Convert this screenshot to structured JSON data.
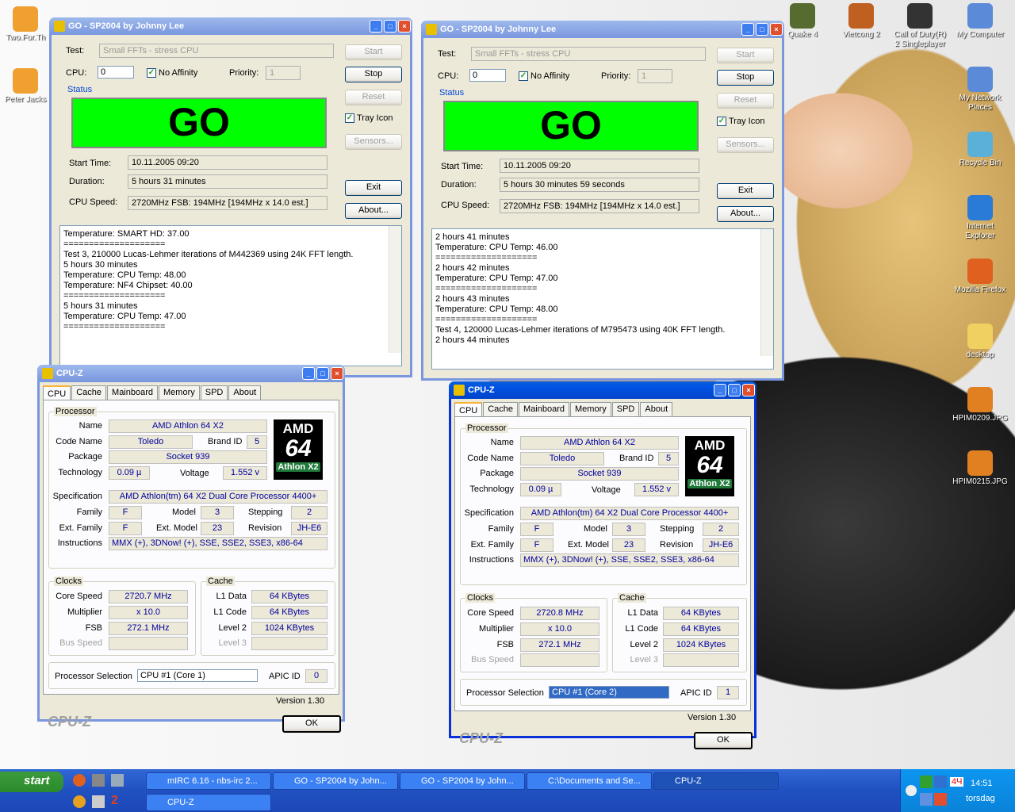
{
  "desktop_icons": [
    {
      "label": "Two.For.Th",
      "img": "#f0a030"
    },
    {
      "label": "Peter Jacks",
      "img": "#f0a030"
    },
    {
      "label": "Quake 4",
      "img": "#556b2f"
    },
    {
      "label": "Vietcong 2",
      "img": "#c06020"
    },
    {
      "label": "Call of Duty(R) 2 Singleplayer",
      "img": "#333"
    },
    {
      "label": "My Computer",
      "img": "#5a8ad8"
    },
    {
      "label": "My Network Places",
      "img": "#5a8ad8"
    },
    {
      "label": "Recycle Bin",
      "img": "#5ab0d8"
    },
    {
      "label": "Internet Explorer",
      "img": "#2a7ad8"
    },
    {
      "label": "Mozilla Firefox",
      "img": "#e06020"
    },
    {
      "label": "desktop",
      "img": "#f0d060"
    },
    {
      "label": "HPIM0209.JPG",
      "img": "#e08020"
    },
    {
      "label": "HPIM0215.JPG",
      "img": "#e08020"
    }
  ],
  "sp1": {
    "title": "GO - SP2004 by Johnny Lee",
    "test_label": "Test:",
    "test_value": "Small FFTs - stress CPU",
    "cpu_label": "CPU:",
    "cpu_value": "0",
    "affinity": "No Affinity",
    "priority_label": "Priority:",
    "priority_value": "1",
    "start": "Start",
    "stop": "Stop",
    "reset": "Reset",
    "tray": "Tray Icon",
    "sensors": "Sensors...",
    "exit": "Exit",
    "about": "About...",
    "status": "Status",
    "go": "GO",
    "start_time_label": "Start Time:",
    "start_time": "10.11.2005 09:20",
    "duration_label": "Duration:",
    "duration": "5 hours 31 minutes",
    "speed_label": "CPU Speed:",
    "speed": "2720MHz FSB: 194MHz [194MHz x 14.0 est.]",
    "log": "Temperature: SMART HD: 37.00\n====================\nTest 3, 210000 Lucas-Lehmer iterations of M442369 using 24K FFT length.\n5 hours 30 minutes\nTemperature: CPU Temp: 48.00\nTemperature: NF4 Chipset: 40.00\n====================\n5 hours 31 minutes\nTemperature: CPU Temp: 47.00\n===================="
  },
  "sp2": {
    "title": "GO - SP2004 by Johnny Lee",
    "test_label": "Test:",
    "test_value": "Small FFTs - stress CPU",
    "cpu_label": "CPU:",
    "cpu_value": "0",
    "affinity": "No Affinity",
    "priority_label": "Priority:",
    "priority_value": "1",
    "start": "Start",
    "stop": "Stop",
    "reset": "Reset",
    "tray": "Tray Icon",
    "sensors": "Sensors...",
    "exit": "Exit",
    "about": "About...",
    "status": "Status",
    "go": "GO",
    "start_time_label": "Start Time:",
    "start_time": "10.11.2005 09:20",
    "duration_label": "Duration:",
    "duration": "5 hours 30 minutes 59 seconds",
    "speed_label": "CPU Speed:",
    "speed": "2720MHz FSB: 194MHz [194MHz x 14.0 est.]",
    "log": "2 hours 41 minutes\nTemperature: CPU Temp: 46.00\n====================\n2 hours 42 minutes\nTemperature: CPU Temp: 47.00\n====================\n2 hours 43 minutes\nTemperature: CPU Temp: 48.00\n====================\nTest 4, 120000 Lucas-Lehmer iterations of M795473 using 40K FFT length.\n2 hours 44 minutes"
  },
  "cz1": {
    "title": "CPU-Z",
    "tabs": [
      "CPU",
      "Cache",
      "Mainboard",
      "Memory",
      "SPD",
      "About"
    ],
    "processor": "Processor",
    "name_l": "Name",
    "name": "AMD Athlon 64 X2",
    "codename_l": "Code Name",
    "codename": "Toledo",
    "brandid_l": "Brand ID",
    "brandid": "5",
    "package_l": "Package",
    "package": "Socket 939",
    "tech_l": "Technology",
    "tech": "0.09 µ",
    "voltage_l": "Voltage",
    "voltage": "1.552 v",
    "spec_l": "Specification",
    "spec": "AMD Athlon(tm) 64 X2 Dual Core Processor 4400+",
    "family_l": "Family",
    "family": "F",
    "model_l": "Model",
    "model": "3",
    "stepping_l": "Stepping",
    "stepping": "2",
    "extfam_l": "Ext. Family",
    "extfam": "F",
    "extmodel_l": "Ext. Model",
    "extmodel": "23",
    "revision_l": "Revision",
    "revision": "JH-E6",
    "instr_l": "Instructions",
    "instr": "MMX (+), 3DNow! (+), SSE, SSE2, SSE3, x86-64",
    "clocks": "Clocks",
    "core_l": "Core Speed",
    "core": "2720.7 MHz",
    "mult_l": "Multiplier",
    "mult": "x 10.0",
    "fsb_l": "FSB",
    "fsb": "272.1 MHz",
    "bus_l": "Bus Speed",
    "cache": "Cache",
    "l1d_l": "L1 Data",
    "l1d": "64 KBytes",
    "l1c_l": "L1 Code",
    "l1c": "64 KBytes",
    "l2_l": "Level 2",
    "l2": "1024 KBytes",
    "l3_l": "Level 3",
    "sel_l": "Processor Selection",
    "sel": "CPU #1 (Core 1)",
    "apic_l": "APIC ID",
    "apic": "0",
    "version": "Version 1.30",
    "logo": "CPU-Z",
    "ok": "OK",
    "amd": "AMD",
    "amd64": "64",
    "athlon": "Athlon X2"
  },
  "cz2": {
    "title": "CPU-Z",
    "tabs": [
      "CPU",
      "Cache",
      "Mainboard",
      "Memory",
      "SPD",
      "About"
    ],
    "processor": "Processor",
    "name_l": "Name",
    "name": "AMD Athlon 64 X2",
    "codename_l": "Code Name",
    "codename": "Toledo",
    "brandid_l": "Brand ID",
    "brandid": "5",
    "package_l": "Package",
    "package": "Socket 939",
    "tech_l": "Technology",
    "tech": "0.09 µ",
    "voltage_l": "Voltage",
    "voltage": "1.552 v",
    "spec_l": "Specification",
    "spec": "AMD Athlon(tm) 64 X2 Dual Core Processor 4400+",
    "family_l": "Family",
    "family": "F",
    "model_l": "Model",
    "model": "3",
    "stepping_l": "Stepping",
    "stepping": "2",
    "extfam_l": "Ext. Family",
    "extfam": "F",
    "extmodel_l": "Ext. Model",
    "extmodel": "23",
    "revision_l": "Revision",
    "revision": "JH-E6",
    "instr_l": "Instructions",
    "instr": "MMX (+), 3DNow! (+), SSE, SSE2, SSE3, x86-64",
    "clocks": "Clocks",
    "core_l": "Core Speed",
    "core": "2720.8 MHz",
    "mult_l": "Multiplier",
    "mult": "x 10.0",
    "fsb_l": "FSB",
    "fsb": "272.1 MHz",
    "bus_l": "Bus Speed",
    "cache": "Cache",
    "l1d_l": "L1 Data",
    "l1d": "64 KBytes",
    "l1c_l": "L1 Code",
    "l1c": "64 KBytes",
    "l2_l": "Level 2",
    "l2": "1024 KBytes",
    "l3_l": "Level 3",
    "sel_l": "Processor Selection",
    "sel": "CPU #1 (Core 2)",
    "apic_l": "APIC ID",
    "apic": "1",
    "version": "Version 1.30",
    "logo": "CPU-Z",
    "ok": "OK",
    "amd": "AMD",
    "amd64": "64",
    "athlon": "Athlon X2"
  },
  "taskbar": {
    "start": "start",
    "items": [
      "mIRC 6.16 - nbs-irc 2...",
      "GO - SP2004 by John...",
      "GO - SP2004 by John...",
      "C:\\Documents and Se...",
      "CPU-Z"
    ],
    "item2": "CPU-Z",
    "time": "14:51",
    "day": "torsdag",
    "lang": "4Ч",
    "quick": "2"
  }
}
